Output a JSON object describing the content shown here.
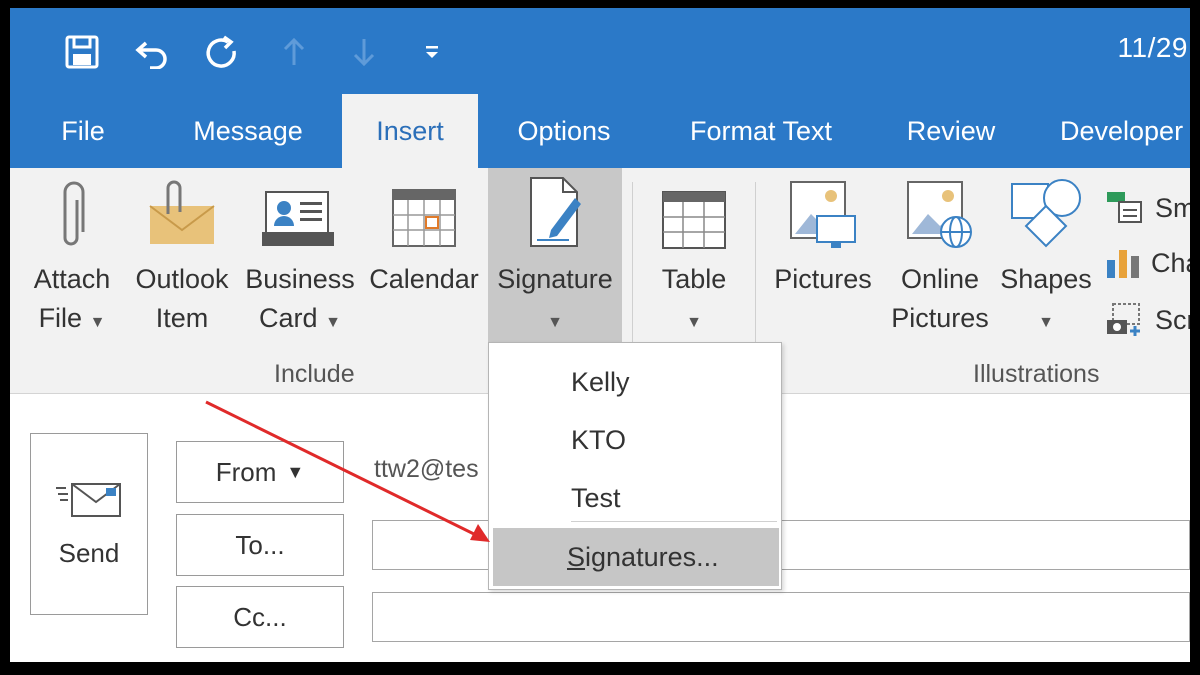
{
  "window": {
    "time_text": "11/29"
  },
  "quick_access": {
    "icons": [
      "save-icon",
      "undo-icon",
      "redo-icon",
      "up-arrow-icon",
      "down-arrow-icon",
      "customize-icon"
    ]
  },
  "tabs": [
    {
      "label": "File",
      "active": false
    },
    {
      "label": "Message",
      "active": false
    },
    {
      "label": "Insert",
      "active": true
    },
    {
      "label": "Options",
      "active": false
    },
    {
      "label": "Format Text",
      "active": false
    },
    {
      "label": "Review",
      "active": false
    },
    {
      "label": "Developer",
      "active": false
    }
  ],
  "ribbon": {
    "include": {
      "group_label": "Include",
      "attach_file": {
        "line1": "Attach",
        "line2": "File"
      },
      "outlook_item": {
        "line1": "Outlook",
        "line2": "Item"
      },
      "business_card": {
        "line1": "Business",
        "line2": "Card"
      },
      "calendar": {
        "line1": "Calendar"
      },
      "signature": {
        "line1": "Signature"
      }
    },
    "tables": {
      "table": {
        "line1": "Table"
      }
    },
    "illustrations": {
      "group_label": "Illustrations",
      "pictures": {
        "line1": "Pictures"
      },
      "online_pictures": {
        "line1": "Online",
        "line2": "Pictures"
      },
      "shapes": {
        "line1": "Shapes"
      },
      "smartart_partial": "Sma",
      "chart_partial": "Cha",
      "screenshot_partial": "Scre"
    }
  },
  "compose": {
    "send_label": "Send",
    "from_label": "From",
    "from_address_partial": "ttw2@tes",
    "to_label": "To...",
    "cc_label": "Cc...",
    "to_value": "",
    "cc_value": ""
  },
  "signature_menu": {
    "items": [
      "Kelly",
      "KTO",
      "Test"
    ],
    "manage_first_letter": "S",
    "manage_rest": "ignatures..."
  },
  "annotation": {
    "arrow_color": "#e02a2a"
  },
  "colors": {
    "ribbon_blue": "#2b79c8",
    "ribbon_bg": "#f2f2f2",
    "active_tab_text": "#2b6fb9"
  }
}
